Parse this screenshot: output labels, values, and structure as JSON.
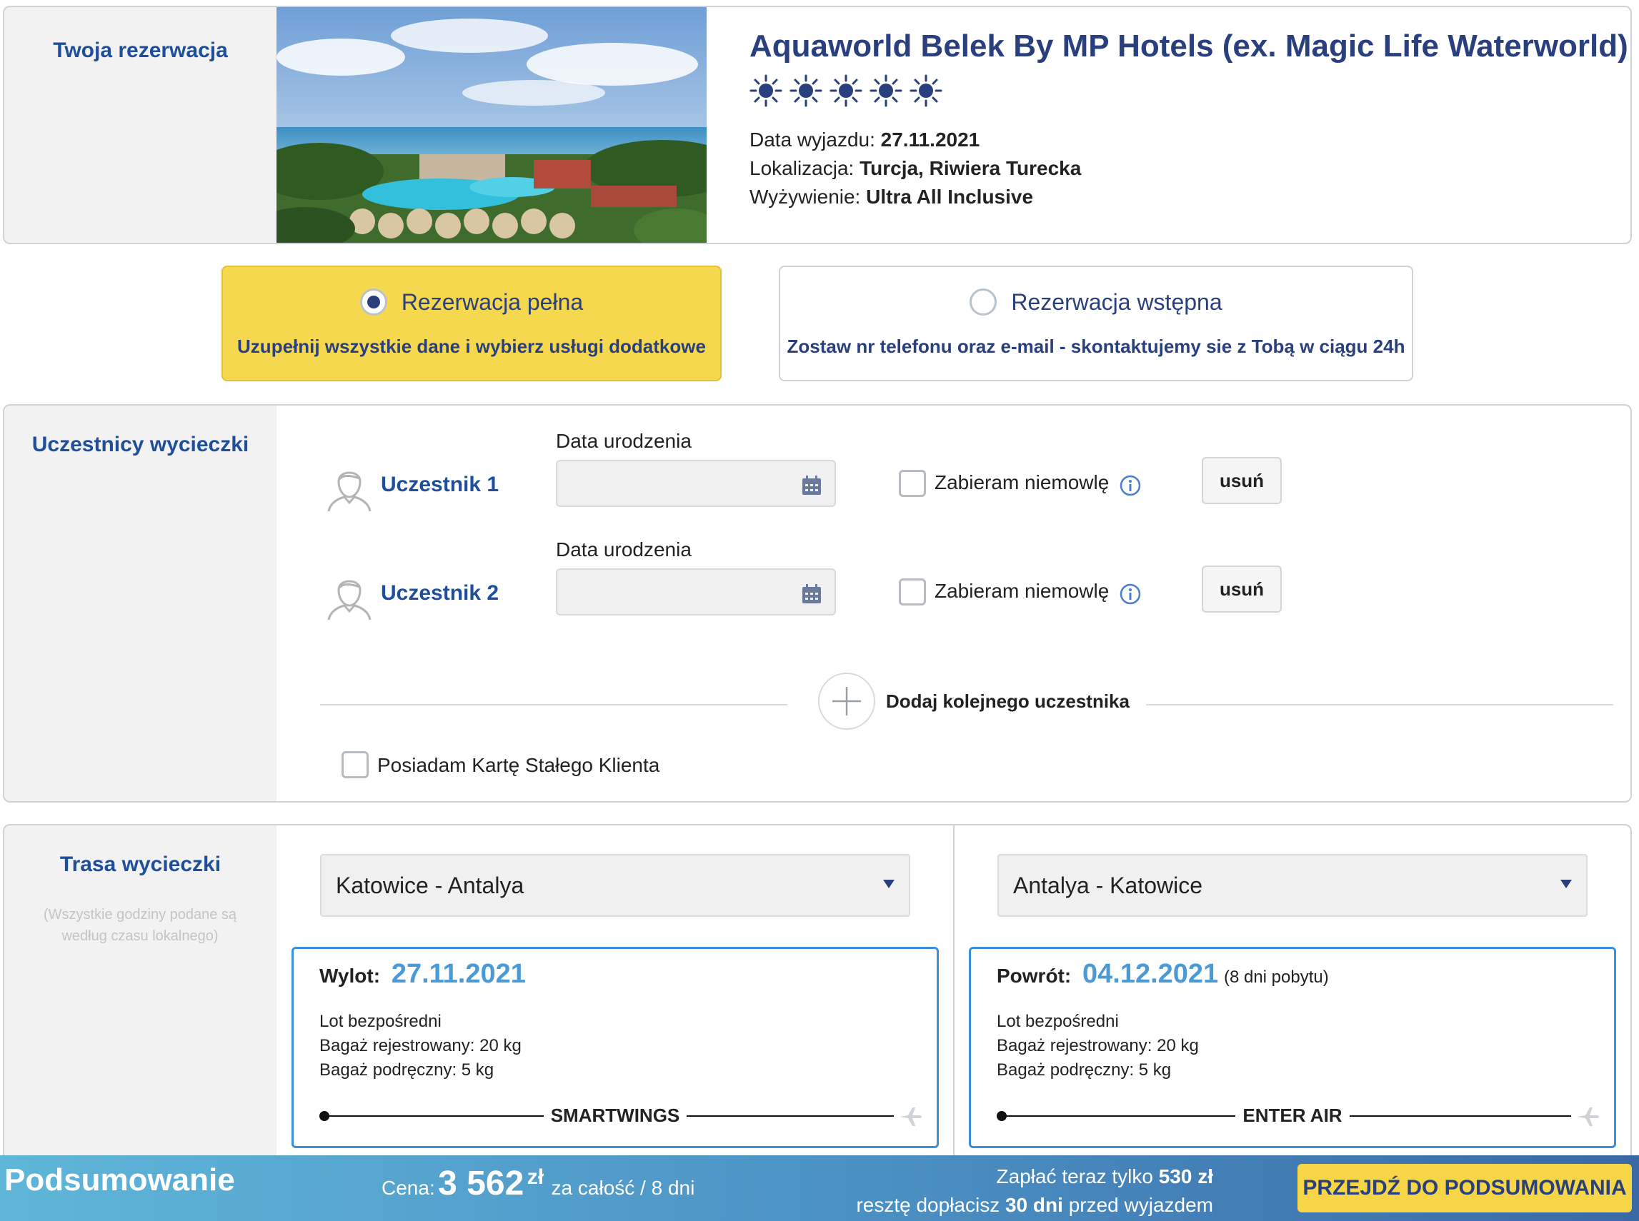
{
  "hotel": {
    "section_title": "Twoja rezerwacja",
    "name": "Aquaworld Belek By MP Hotels (ex. Magic Life Waterworld)",
    "stars": 5,
    "departure_label": "Data wyjazdu:",
    "departure_value": "27.11.2021",
    "location_label": "Lokalizacja:",
    "location_value": "Turcja, Riwiera Turecka",
    "board_label": "Wyżywienie:",
    "board_value": "Ultra All Inclusive"
  },
  "reservation_type": {
    "full": {
      "title": "Rezerwacja pełna",
      "desc": "Uzupełnij wszystkie dane i wybierz usługi dodatkowe",
      "selected": true
    },
    "prelim": {
      "title": "Rezerwacja wstępna",
      "desc": "Zostaw nr telefonu oraz e-mail - skontaktujemy sie z Tobą w ciągu 24h",
      "selected": false
    }
  },
  "participants": {
    "section_title": "Uczestnicy wycieczki",
    "items": [
      {
        "name": "Uczestnik 1",
        "dob_label": "Data urodzenia",
        "dob_value": "",
        "infant_label": "Zabieram niemowlę",
        "remove_label": "usuń"
      },
      {
        "name": "Uczestnik 2",
        "dob_label": "Data urodzenia",
        "dob_value": "",
        "infant_label": "Zabieram niemowlę",
        "remove_label": "usuń"
      }
    ],
    "add_label": "Dodaj kolejnego uczestnika",
    "loyalty_label": "Posiadam Kartę Stałego Klienta"
  },
  "route": {
    "section_title": "Trasa wycieczki",
    "note": "(Wszystkie godziny podane są według czasu lokalnego)",
    "outbound": {
      "select": "Katowice - Antalya",
      "label": "Wylot:",
      "date": "27.11.2021",
      "extra": "",
      "lines": [
        "Lot bezpośredni",
        "Bagaż rejestrowany: 20 kg",
        "Bagaż podręczny: 5 kg"
      ],
      "carrier": "SMARTWINGS"
    },
    "inbound": {
      "select": "Antalya - Katowice",
      "label": "Powrót:",
      "date": "04.12.2021",
      "extra": "(8 dni pobytu)",
      "lines": [
        "Lot bezpośredni",
        "Bagaż rejestrowany: 20 kg",
        "Bagaż podręczny: 5 kg"
      ],
      "carrier": "ENTER AIR"
    }
  },
  "summary": {
    "title": "Podsumowanie",
    "price_label": "Cena:",
    "price_value": "3 562",
    "currency": "zł",
    "price_suffix": "za całość / 8 dni",
    "pay_now_prefix": "Zapłać teraz tylko",
    "pay_now_value": "530 zł",
    "rest_prefix": "resztę dopłacisz",
    "rest_value": "30 dni",
    "rest_suffix": "przed wyjazdem",
    "cta": "PRZEJDŹ DO PODSUMOWANIA"
  },
  "colors": {
    "accent": "#1f4f9a",
    "cta": "#f6d646",
    "date_blue": "#4a9ad8",
    "flight_border": "#3d8fd6"
  }
}
